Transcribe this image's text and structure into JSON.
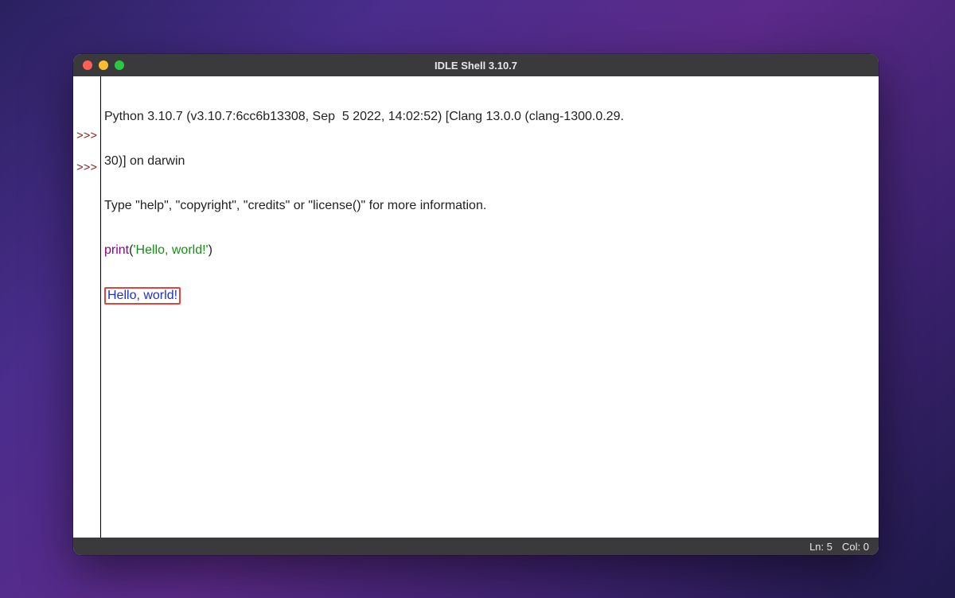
{
  "window": {
    "title": "IDLE Shell 3.10.7"
  },
  "shell": {
    "banner_line1": "Python 3.10.7 (v3.10.7:6cc6b13308, Sep  5 2022, 14:02:52) [Clang 13.0.0 (clang-1300.0.29.",
    "banner_line2": "30)] on darwin",
    "banner_line3": "Type \"help\", \"copyright\", \"credits\" or \"license()\" for more information.",
    "prompt": ">>>",
    "input_call": "print",
    "input_paren_open": "(",
    "input_string": "'Hello, world!'",
    "input_paren_close": ")",
    "output": "Hello, world!"
  },
  "status": {
    "line_label": "Ln:",
    "line_value": "5",
    "col_label": "Col:",
    "col_value": "0"
  }
}
